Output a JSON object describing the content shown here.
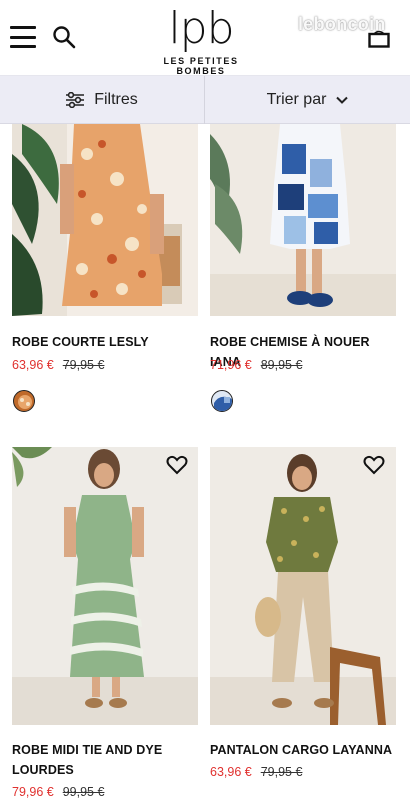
{
  "header": {
    "logo_mark": "lpb",
    "logo_subtitle": "LES PETITES BOMBES",
    "watermark": "leboncoin",
    "icons": [
      "menu-icon",
      "search-icon",
      "shopping-bag-icon"
    ]
  },
  "toolbar": {
    "filters_label": "Filtres",
    "sort_label": "Trier par"
  },
  "products": [
    {
      "title": "ROBE COURTE LESLY",
      "price": "63,96 €",
      "old_price": "79,95 €",
      "swatch_color": "#c06a2a"
    },
    {
      "title": "ROBE CHEMISE À NOUER IANA",
      "price": "71,96 €",
      "old_price": "89,95 €",
      "swatch_color": "#2f5ea8"
    },
    {
      "title": "ROBE MIDI TIE AND DYE",
      "title_line2": "LOURDES",
      "price": "79,96 €",
      "old_price": "99,95 €"
    },
    {
      "title": "PANTALON CARGO LAYANNA",
      "price": "63,96 €",
      "old_price": "79,95 €"
    }
  ],
  "colors": {
    "sale_price": "#e0312f",
    "filter_bar_bg": "#ececf5"
  }
}
